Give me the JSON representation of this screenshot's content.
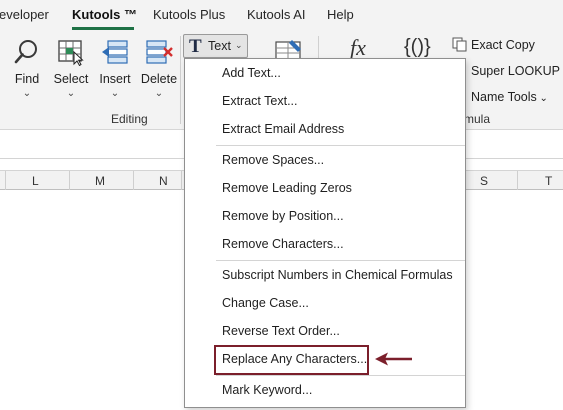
{
  "tabs": [
    {
      "label": "eveloper",
      "active": false
    },
    {
      "label": "Kutools ™",
      "active": true
    },
    {
      "label": "Kutools Plus",
      "active": false
    },
    {
      "label": "Kutools AI",
      "active": false
    },
    {
      "label": "Help",
      "active": false
    }
  ],
  "ribbon": {
    "buttons": [
      {
        "label": "Find",
        "icon": "magnifier-icon"
      },
      {
        "label": "Select",
        "icon": "select-grid-icon"
      },
      {
        "label": "Insert",
        "icon": "insert-rows-icon"
      },
      {
        "label": "Delete",
        "icon": "delete-rows-icon"
      }
    ],
    "group_label": "Editing",
    "text_button": {
      "icon": "T",
      "label": "Text"
    },
    "formula_icon": "fx",
    "braces_icon": "{()}",
    "right_items": [
      {
        "label": "Exact Copy"
      },
      {
        "label": "Super LOOKUP"
      },
      {
        "label": "Name Tools"
      }
    ],
    "formula_group_label": "mula"
  },
  "columns": [
    "L",
    "M",
    "N",
    "S",
    "T"
  ],
  "menu": {
    "items": [
      {
        "label": "Add Text...",
        "highlighted": false
      },
      {
        "label": "Extract Text...",
        "highlighted": false
      },
      {
        "label": "Extract Email Address",
        "highlighted": false
      },
      {
        "label": "Remove Spaces...",
        "highlighted": false
      },
      {
        "label": "Remove Leading Zeros",
        "highlighted": false
      },
      {
        "label": "Remove by Position...",
        "highlighted": false
      },
      {
        "label": "Remove Characters...",
        "highlighted": false
      },
      {
        "label": "Subscript Numbers in Chemical Formulas",
        "highlighted": false
      },
      {
        "label": "Change Case...",
        "highlighted": false
      },
      {
        "label": "Reverse Text Order...",
        "highlighted": false
      },
      {
        "label": "Replace Any Characters...",
        "highlighted": true
      },
      {
        "label": "Mark Keyword...",
        "highlighted": false
      }
    ]
  },
  "colors": {
    "accent": "#1e7145",
    "highlight_border": "#7b1f2b",
    "arrow": "#7b1f2b"
  }
}
